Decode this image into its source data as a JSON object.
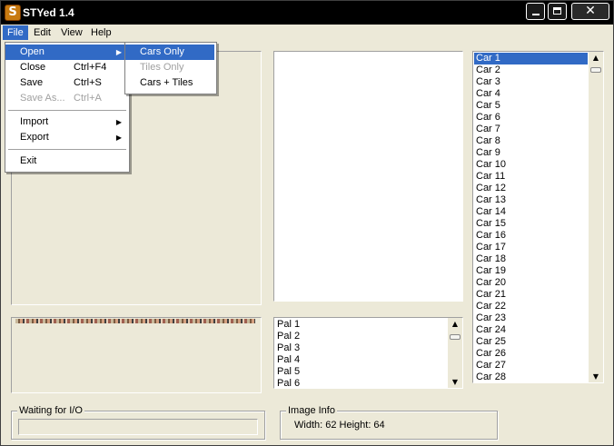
{
  "window": {
    "title": "STYed 1.4",
    "close_glyph": "✕"
  },
  "menubar": {
    "items": [
      "File",
      "Edit",
      "View",
      "Help"
    ]
  },
  "file_menu": {
    "items": [
      {
        "label": "Open",
        "shortcut": "",
        "submenu": true,
        "disabled": false,
        "highlighted": true
      },
      {
        "label": "Close",
        "shortcut": "Ctrl+F4",
        "submenu": false,
        "disabled": false
      },
      {
        "label": "Save",
        "shortcut": "Ctrl+S",
        "submenu": false,
        "disabled": false
      },
      {
        "label": "Save As...",
        "shortcut": "Ctrl+A",
        "submenu": false,
        "disabled": true
      },
      {
        "label": "Import",
        "shortcut": "",
        "submenu": true,
        "disabled": false
      },
      {
        "label": "Export",
        "shortcut": "",
        "submenu": true,
        "disabled": false
      },
      {
        "label": "Exit",
        "shortcut": "",
        "submenu": false,
        "disabled": false
      }
    ]
  },
  "open_submenu": {
    "items": [
      {
        "label": "Cars Only",
        "disabled": false,
        "highlighted": true
      },
      {
        "label": "Tiles Only",
        "disabled": true
      },
      {
        "label": "Cars + Tiles",
        "disabled": false
      }
    ]
  },
  "palette_list": {
    "items": [
      "Pal 1",
      "Pal 2",
      "Pal 3",
      "Pal 4",
      "Pal 5",
      "Pal 6"
    ]
  },
  "car_list": {
    "selected": "Car 1",
    "items": [
      "Car 1",
      "Car 2",
      "Car 3",
      "Car 4",
      "Car 5",
      "Car 6",
      "Car 7",
      "Car 8",
      "Car 9",
      "Car 10",
      "Car 11",
      "Car 12",
      "Car 13",
      "Car 14",
      "Car 15",
      "Car 16",
      "Car 17",
      "Car 18",
      "Car 19",
      "Car 20",
      "Car 21",
      "Car 22",
      "Car 23",
      "Car 24",
      "Car 25",
      "Car 26",
      "Car 27",
      "Car 28"
    ]
  },
  "status": {
    "label": "Waiting for I/O",
    "progress": 0
  },
  "image_info": {
    "label": "Image Info",
    "text": "Width: 62 Height: 64"
  },
  "icons": {
    "app": "S",
    "submenu_arrow": "▶",
    "scroll_up": "▲",
    "scroll_down": "▼"
  }
}
